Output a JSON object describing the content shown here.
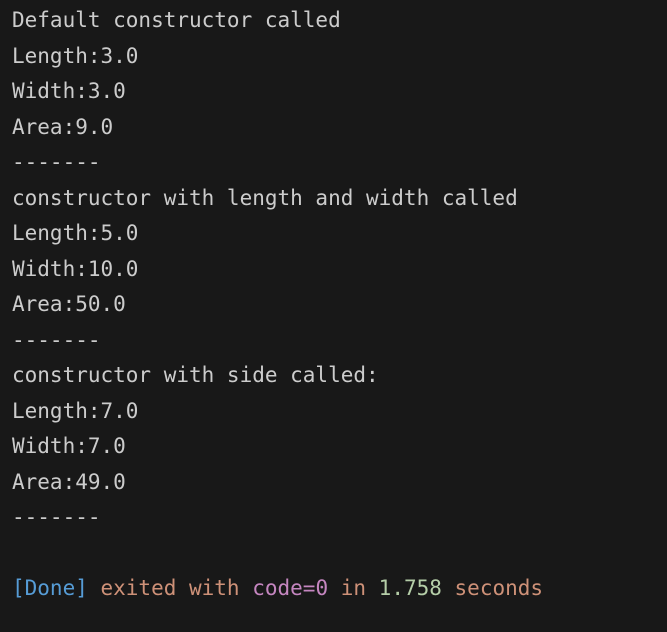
{
  "output": {
    "lines": [
      "Default constructor called",
      "Length:3.0",
      "Width:3.0",
      "Area:9.0",
      "-------",
      "constructor with length and width called",
      "Length:5.0",
      "Width:10.0",
      "Area:50.0",
      "-------",
      "constructor with side called:",
      "Length:7.0",
      "Width:7.0",
      "Area:49.0",
      "-------"
    ]
  },
  "status": {
    "tag": "[Done]",
    "text_before": " exited with ",
    "code": "code=0",
    "text_mid": " in ",
    "duration": "1.758",
    "text_after": " seconds"
  },
  "colors": {
    "background": "#181818",
    "text": "#cccccc",
    "done_tag": "#569cd6",
    "status_text": "#ce9178",
    "code": "#c586c0",
    "duration": "#b5cea8"
  }
}
